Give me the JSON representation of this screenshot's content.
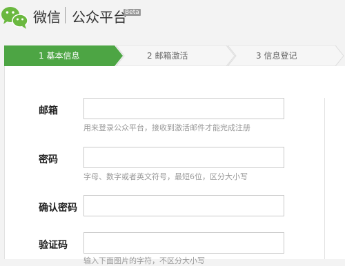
{
  "header": {
    "app_name": "微信",
    "platform_name": "公众平台",
    "badge": "Beta"
  },
  "steps": [
    {
      "label": "1 基本信息",
      "active": true
    },
    {
      "label": "2 邮箱激活",
      "active": false
    },
    {
      "label": "3 信息登记",
      "active": false
    }
  ],
  "colors": {
    "accent_green": "#4da544",
    "step_inactive": "#f6f6f6",
    "hint_text": "#999999"
  },
  "form": {
    "email": {
      "label": "邮箱",
      "value": "",
      "hint": "用来登录公众平台，接收到激活邮件才能完成注册"
    },
    "password": {
      "label": "密码",
      "value": "",
      "hint": "字母、数字或者英文符号，最短6位，区分大小写"
    },
    "confirm_password": {
      "label": "确认密码",
      "value": ""
    },
    "captcha": {
      "label": "验证码",
      "value": "",
      "hint": "输入下面图片的字符，不区分大小写"
    }
  }
}
